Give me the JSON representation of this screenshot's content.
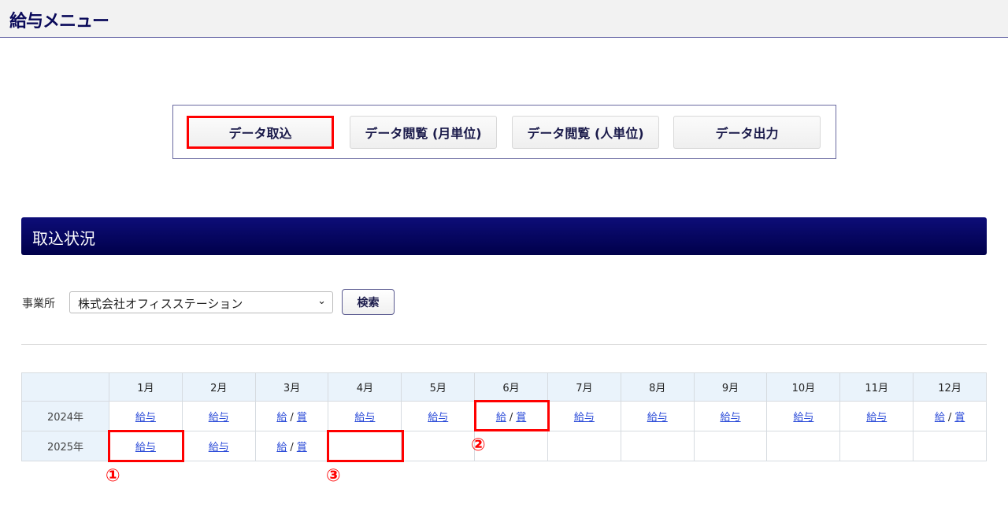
{
  "header": {
    "title": "給与メニュー"
  },
  "menu": [
    {
      "label": "データ取込",
      "selected": true
    },
    {
      "label": "データ閲覧 (月単位)",
      "selected": false
    },
    {
      "label": "データ閲覧 (人単位)",
      "selected": false
    },
    {
      "label": "データ出力",
      "selected": false
    }
  ],
  "section": {
    "title": "取込状況"
  },
  "filter": {
    "label": "事業所",
    "office_value": "株式会社オフィスステーション",
    "search_label": "検索"
  },
  "table": {
    "months": [
      "1月",
      "2月",
      "3月",
      "4月",
      "5月",
      "6月",
      "7月",
      "8月",
      "9月",
      "10月",
      "11月",
      "12月"
    ],
    "rows": [
      {
        "year": "2024年",
        "cells": [
          "給与",
          "給与",
          "給/賞",
          "給与",
          "給与",
          "給/賞",
          "給与",
          "給与",
          "給与",
          "給与",
          "給与",
          "給/賞"
        ]
      },
      {
        "year": "2025年",
        "cells": [
          "給与",
          "給与",
          "給/賞",
          "",
          "",
          "",
          "",
          "",
          "",
          "",
          "",
          ""
        ]
      }
    ],
    "link_parts": {
      "kyu": "給",
      "sho": "賞",
      "slash": "/"
    }
  },
  "annotations": [
    "①",
    "②",
    "③"
  ],
  "colors": {
    "navy": "#00004a",
    "highlight": "#ff0000",
    "link": "#2a4ad8"
  }
}
